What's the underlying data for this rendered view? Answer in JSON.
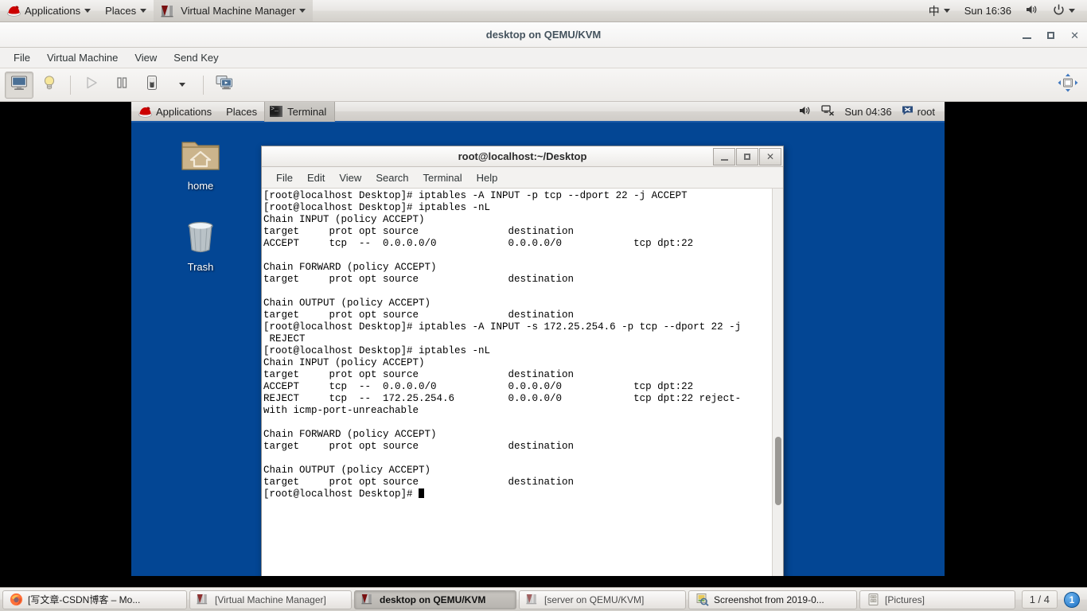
{
  "host_panel": {
    "applications_label": "Applications",
    "places_label": "Places",
    "active_app_label": "Virtual Machine Manager",
    "input_method": "中",
    "clock": "Sun 16:36",
    "icons": [
      "redhat-logo-icon",
      "chevron-down-icon",
      "vmm-icon",
      "volume-icon",
      "power-icon"
    ]
  },
  "vmm_window": {
    "title": "desktop on QEMU/KVM",
    "window_buttons": [
      "minimize",
      "maximize",
      "close"
    ],
    "menus": [
      "File",
      "Virtual Machine",
      "View",
      "Send Key"
    ],
    "toolbar": [
      {
        "name": "show-graphical-console",
        "state": "pressed"
      },
      {
        "name": "show-virtual-hardware-details",
        "state": "normal"
      },
      {
        "name": "run-vm",
        "state": "disabled"
      },
      {
        "name": "pause-vm",
        "state": "normal"
      },
      {
        "name": "shutdown-vm",
        "state": "normal"
      },
      {
        "name": "shutdown-options-dropdown",
        "state": "normal"
      },
      {
        "name": "manage-snapshots",
        "state": "normal"
      },
      {
        "name": "resize-to-vm",
        "state": "normal"
      }
    ]
  },
  "guest": {
    "panel": {
      "applications_label": "Applications",
      "places_label": "Places",
      "window_task_label": "Terminal",
      "clock": "Sun 04:36",
      "user": "root"
    },
    "desktop_icons": [
      {
        "name": "home",
        "label": "home"
      },
      {
        "name": "trash",
        "label": "Trash"
      }
    ]
  },
  "terminal": {
    "title": "root@localhost:~/Desktop",
    "menus": [
      "File",
      "Edit",
      "View",
      "Search",
      "Terminal",
      "Help"
    ],
    "lines": [
      "[root@localhost Desktop]# iptables -A INPUT -p tcp --dport 22 -j ACCEPT",
      "[root@localhost Desktop]# iptables -nL",
      "Chain INPUT (policy ACCEPT)",
      "target     prot opt source               destination",
      "ACCEPT     tcp  --  0.0.0.0/0            0.0.0.0/0            tcp dpt:22",
      "",
      "Chain FORWARD (policy ACCEPT)",
      "target     prot opt source               destination",
      "",
      "Chain OUTPUT (policy ACCEPT)",
      "target     prot opt source               destination",
      "[root@localhost Desktop]# iptables -A INPUT -s 172.25.254.6 -p tcp --dport 22 -j",
      " REJECT",
      "[root@localhost Desktop]# iptables -nL",
      "Chain INPUT (policy ACCEPT)",
      "target     prot opt source               destination",
      "ACCEPT     tcp  --  0.0.0.0/0            0.0.0.0/0            tcp dpt:22",
      "REJECT     tcp  --  172.25.254.6         0.0.0.0/0            tcp dpt:22 reject-",
      "with icmp-port-unreachable",
      "",
      "Chain FORWARD (policy ACCEPT)",
      "target     prot opt source               destination",
      "",
      "Chain OUTPUT (policy ACCEPT)",
      "target     prot opt source               destination"
    ],
    "prompt": "[root@localhost Desktop]# "
  },
  "taskbar": {
    "buttons": [
      {
        "name": "firefox-window",
        "icon": "firefox-icon",
        "label": "[写文章-CSDN博客 – Mo..."
      },
      {
        "name": "vmm-window",
        "icon": "vmm-icon",
        "label": "[Virtual Machine Manager]"
      },
      {
        "name": "desktop-vm-window",
        "icon": "vmm-icon",
        "label": "desktop on QEMU/KVM",
        "active": true
      },
      {
        "name": "server-vm-window",
        "icon": "vmm-icon",
        "label": "[server on QEMU/KVM]"
      },
      {
        "name": "screenshot-window",
        "icon": "screenshot-icon",
        "label": "Screenshot from 2019-0..."
      },
      {
        "name": "pictures-window",
        "icon": "files-icon",
        "label": "[Pictures]"
      }
    ],
    "workspace_indicator": "1 / 4",
    "workspace_badge": "1"
  },
  "colors": {
    "guest_desktop_blue": "#034694",
    "panel_grey": "#e3e1de",
    "title_blue_grey": "#45535e",
    "terminal_bg": "#ffffff",
    "terminal_fg": "#000000"
  }
}
